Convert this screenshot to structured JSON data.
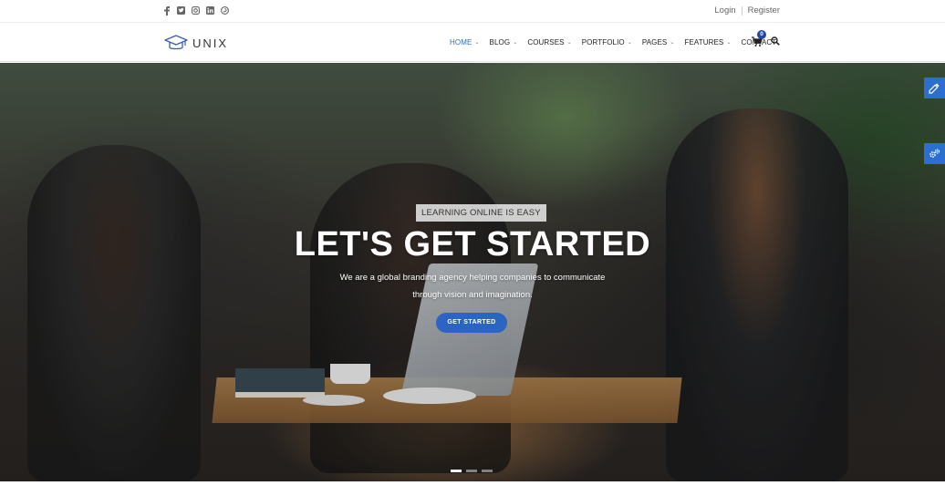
{
  "topbar": {
    "social_icons": [
      "facebook-icon",
      "twitter-icon",
      "instagram-icon",
      "linkedin-icon",
      "pinterest-icon"
    ],
    "login_label": "Login",
    "register_label": "Register"
  },
  "header": {
    "logo_text": "UNIX",
    "nav": [
      {
        "label": "HOME",
        "active": true,
        "dropdown": true
      },
      {
        "label": "BLOG",
        "active": false,
        "dropdown": true
      },
      {
        "label": "COURSES",
        "active": false,
        "dropdown": true
      },
      {
        "label": "PORTFOLIO",
        "active": false,
        "dropdown": true
      },
      {
        "label": "PAGES",
        "active": false,
        "dropdown": true
      },
      {
        "label": "FEATURES",
        "active": false,
        "dropdown": true
      },
      {
        "label": "CONTACT",
        "active": false,
        "dropdown": false
      }
    ],
    "cart_count": "0"
  },
  "hero": {
    "tagline": "LEARNING ONLINE IS EASY",
    "headline": "LET'S GET STARTED",
    "subtext_line1": "We are a global branding agency helping companies to communicate",
    "subtext_line2": "through vision and imagination.",
    "cta_label": "GET STARTED",
    "slides": 3,
    "active_slide": 1
  },
  "colors": {
    "accent": "#2c64c4",
    "nav_active": "#2a6fb0",
    "side_button": "#2d6fd1",
    "cart_badge": "#1f49a8"
  },
  "side_tools": [
    "color-picker-icon",
    "settings-gears-icon"
  ]
}
